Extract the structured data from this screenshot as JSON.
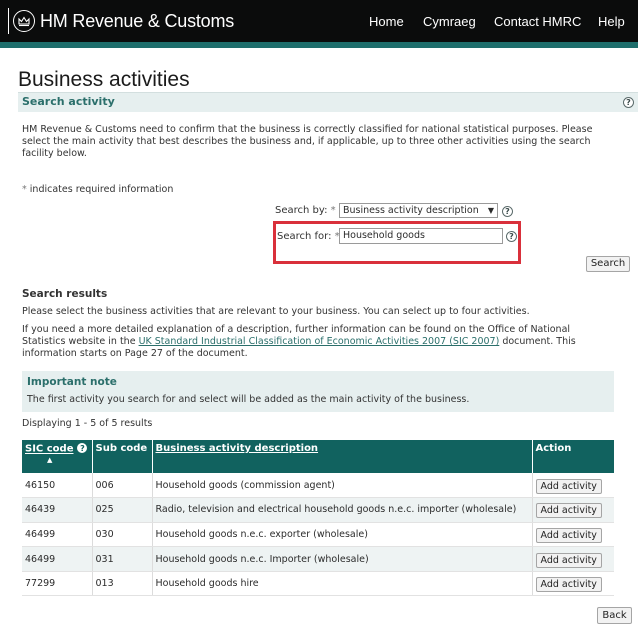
{
  "header": {
    "brand": "HM Revenue & Customs",
    "nav": [
      "Home",
      "Cymraeg",
      "Contact HMRC",
      "Help"
    ]
  },
  "page": {
    "title": "Business activities",
    "section_title": "Search activity",
    "intro": "HM Revenue & Customs need to confirm that the business is correctly classified for national statistical purposes. Please select the main activity that best describes the business and, if applicable, up to three other activities using the search facility below.",
    "required_note": "indicates required information",
    "required_marker": "*"
  },
  "search": {
    "search_by_label": "Search by:",
    "search_by_value": "Business activity description",
    "search_for_label": "Search for:",
    "search_for_value": "Household goods",
    "button": "Search"
  },
  "results": {
    "title": "Search results",
    "instruction": "Please select the business activities that are relevant to your business. You can select up to four activities.",
    "info_prefix": "If you need a more detailed explanation of a description, further information can be found on the Office of National Statistics website in the",
    "info_link": "UK Standard Industrial Classification of Economic Activities 2007 (SIC 2007)",
    "info_suffix": "document. This information starts on Page 27 of the document.",
    "note_title": "Important note",
    "note_text": "The first activity you search for and select will be added as the main activity of the business.",
    "displaying": "Displaying 1 - 5 of 5 results",
    "columns": [
      "SIC code",
      "Sub code",
      "Business activity description",
      "Action"
    ],
    "rows": [
      {
        "sic": "46150",
        "sub": "006",
        "desc": "Household goods (commission agent)",
        "action": "Add activity"
      },
      {
        "sic": "46439",
        "sub": "025",
        "desc": "Radio, television and electrical household goods n.e.c. importer (wholesale)",
        "action": "Add activity"
      },
      {
        "sic": "46499",
        "sub": "030",
        "desc": "Household goods n.e.c. exporter (wholesale)",
        "action": "Add activity"
      },
      {
        "sic": "46499",
        "sub": "031",
        "desc": "Household goods n.e.c. Importer (wholesale)",
        "action": "Add activity"
      },
      {
        "sic": "77299",
        "sub": "013",
        "desc": "Household goods hire",
        "action": "Add activity"
      }
    ],
    "back_button": "Back"
  },
  "colors": {
    "header_bg": "#0b0c0c",
    "accent": "#11625f",
    "highlight": "#d9303b"
  }
}
